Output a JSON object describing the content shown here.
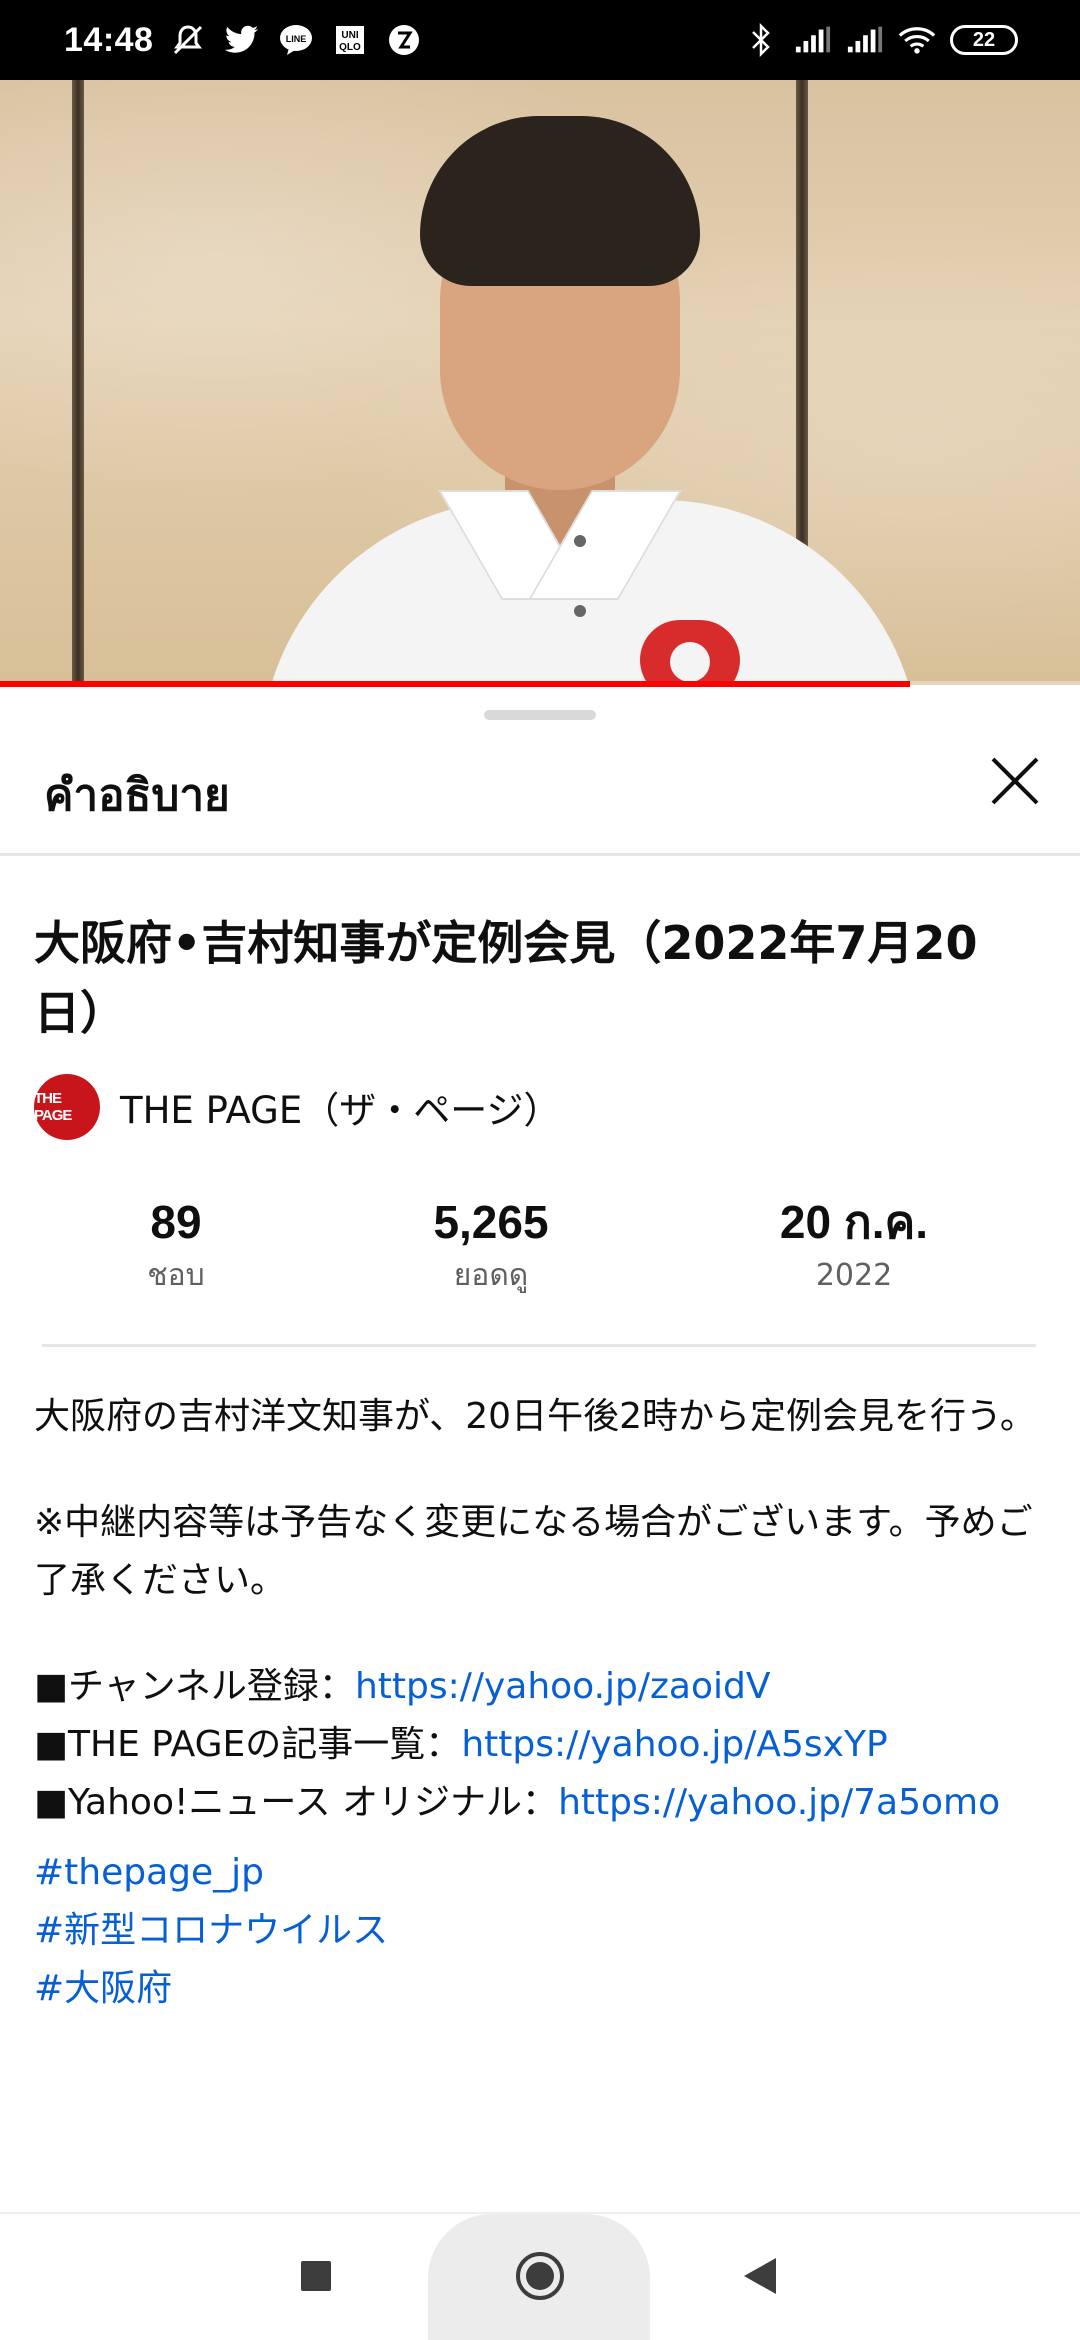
{
  "status_bar": {
    "time": "14:48",
    "left_icons": [
      "mute-icon",
      "twitter-icon",
      "line-icon",
      "uniqlo-icon",
      "app-icon"
    ],
    "right_icons": [
      "bluetooth-icon",
      "signal-icon",
      "signal-icon",
      "wifi-icon"
    ],
    "battery": "22"
  },
  "video": {
    "progress_fraction": 0.843
  },
  "sheet": {
    "title": "คำอธิบาย",
    "close_icon": "close-icon"
  },
  "video_info": {
    "title": "大阪府•吉村知事が定例会見（2022年7月20日）",
    "channel": {
      "logo_text": "THE PAGE",
      "name": "THE PAGE（ザ・ページ）"
    },
    "stats": [
      {
        "value": "89",
        "label": "ชอบ"
      },
      {
        "value": "5,265",
        "label": "ยอดดู"
      },
      {
        "value": "20 ก.ค.",
        "label": "2022"
      }
    ]
  },
  "description": {
    "para1": "大阪府の吉村洋文知事が、20日午後2時から定例会見を行う。",
    "para2": "※中継内容等は予告なく変更になる場合がございます。予めご了承ください。",
    "links": [
      {
        "label": "■チャンネル登録：",
        "url": "https://yahoo.jp/zaoidV"
      },
      {
        "label": "■THE PAGEの記事一覧：",
        "url": "https://yahoo.jp/A5sxYP"
      },
      {
        "label": "■Yahoo!ニュース オリジナル：",
        "url": "https://yahoo.jp/7a5omo"
      }
    ],
    "hashtags": [
      "#thepage_jp",
      "#新型コロナウイルス",
      "#大阪府"
    ]
  },
  "nav_bar": {
    "buttons": [
      "recents-icon",
      "home-icon",
      "back-icon"
    ]
  },
  "colors": {
    "link": "#065fd4",
    "progress": "#ff0000",
    "channel_logo": "#c8151b"
  }
}
